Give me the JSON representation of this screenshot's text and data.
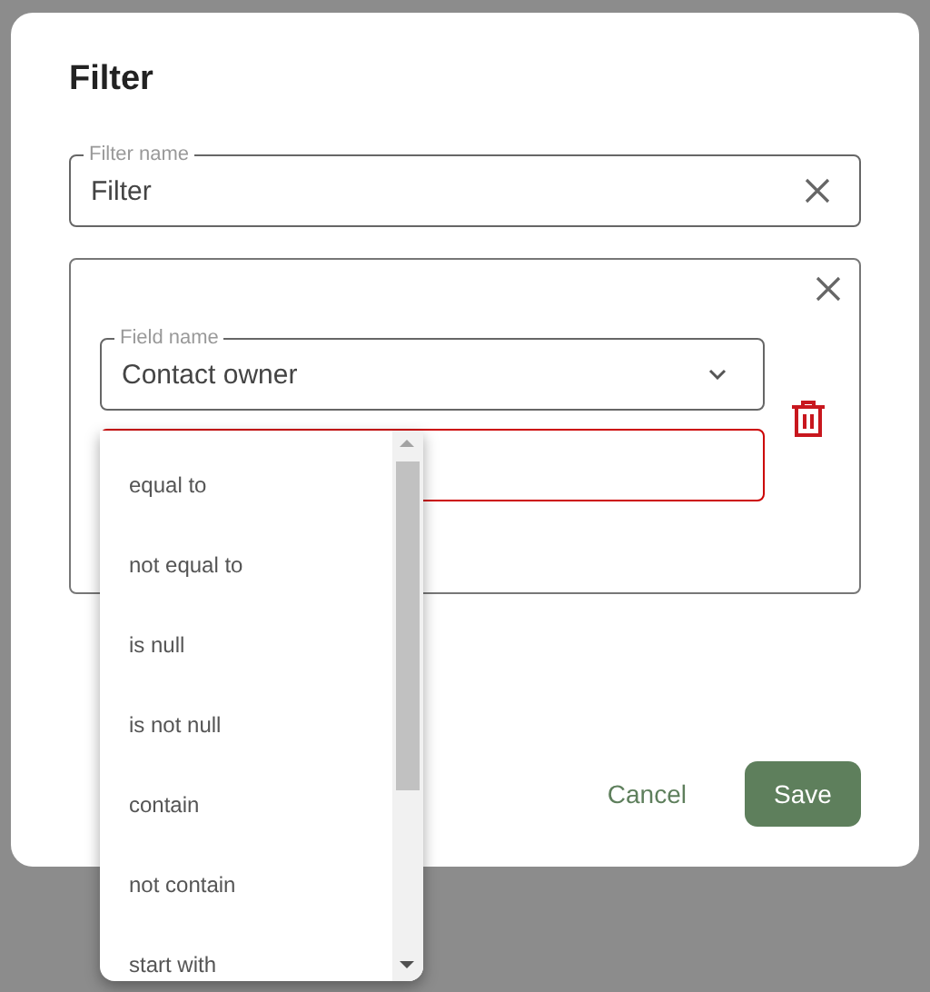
{
  "dialog": {
    "title": "Filter",
    "filter_name": {
      "label": "Filter name",
      "value": "Filter"
    },
    "condition": {
      "field": {
        "label": "Field name",
        "value": "Contact owner"
      },
      "operator": {
        "error": true,
        "expanded": true,
        "options": [
          {
            "label": "equal to",
            "selected": false
          },
          {
            "label": "not equal to",
            "selected": false
          },
          {
            "label": "is null",
            "selected": false
          },
          {
            "label": "is not null",
            "selected": false
          },
          {
            "label": "contain",
            "selected": false
          },
          {
            "label": "not contain",
            "selected": false
          },
          {
            "label": "start with",
            "selected": false
          }
        ]
      }
    },
    "buttons": [
      {
        "label": "Cancel",
        "kind": "text"
      },
      {
        "label": "Save",
        "kind": "primary"
      }
    ]
  }
}
